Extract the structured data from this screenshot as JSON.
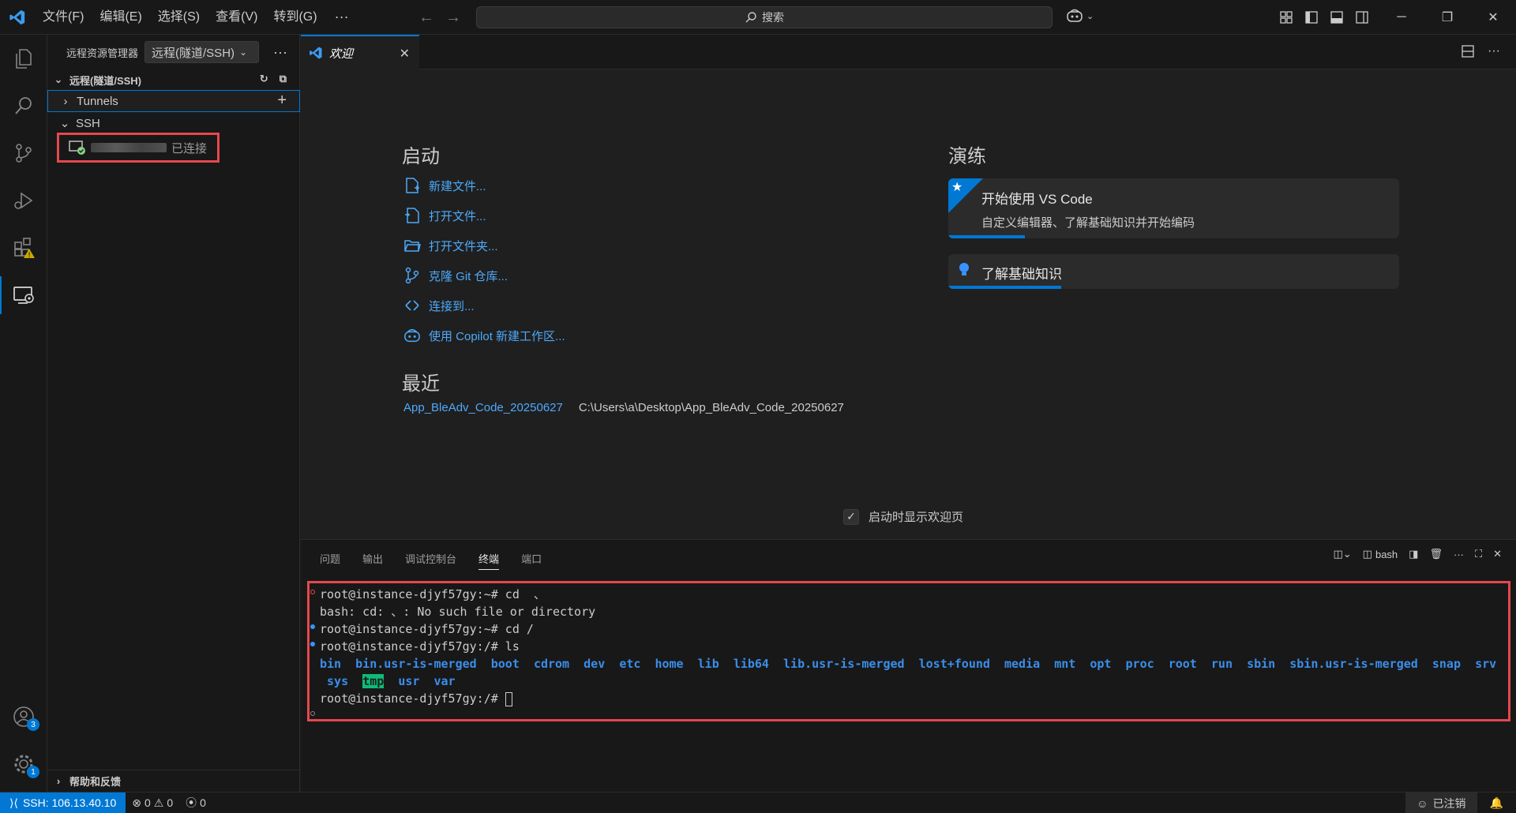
{
  "menu": [
    "文件(F)",
    "编辑(E)",
    "选择(S)",
    "查看(V)",
    "转到(G)"
  ],
  "menu_more": "···",
  "search": {
    "label": "搜索"
  },
  "sidebar": {
    "title": "远程资源管理器",
    "dropdown": "远程(隧道/SSH)",
    "more": "···",
    "section": "远程(隧道/SSH)",
    "tunnels": "Tunnels",
    "ssh": "SSH",
    "host_status": "已连接",
    "footer": "帮助和反馈"
  },
  "badges": {
    "accounts": "3",
    "settings": "1"
  },
  "tab": {
    "label": "欢迎",
    "close": "✕"
  },
  "welcome": {
    "start_heading": "启动",
    "start_items": [
      {
        "label": "新建文件...",
        "icon": "new-file-icon"
      },
      {
        "label": "打开文件...",
        "icon": "open-file-icon"
      },
      {
        "label": "打开文件夹...",
        "icon": "open-folder-icon"
      },
      {
        "label": "克隆 Git 仓库...",
        "icon": "git-icon"
      },
      {
        "label": "连接到...",
        "icon": "remote-icon"
      },
      {
        "label": "使用 Copilot 新建工作区...",
        "icon": "copilot-icon"
      }
    ],
    "recent_heading": "最近",
    "recent": {
      "name": "App_BleAdv_Code_20250627",
      "path": "C:\\Users\\a\\Desktop\\App_BleAdv_Code_20250627"
    },
    "walkthrough_heading": "演练",
    "walkthroughs": [
      {
        "title": "开始使用 VS Code",
        "desc": "自定义编辑器、了解基础知识并开始编码",
        "progress": 0.17
      },
      {
        "title": "了解基础知识",
        "desc": "",
        "progress": 0.25
      }
    ],
    "show_on_startup": "启动时显示欢迎页"
  },
  "panel": {
    "tabs": [
      "问题",
      "输出",
      "调试控制台",
      "终端",
      "端口"
    ],
    "active_tab": "终端",
    "shell": "bash"
  },
  "terminal": {
    "lines": [
      "root@instance-djyf57gy:~# cd  、",
      "bash: cd: 、: No such file or directory",
      "root@instance-djyf57gy:~# cd /",
      "root@instance-djyf57gy:/# ls"
    ],
    "dirs_row1": [
      "bin",
      "bin.usr-is-merged",
      "boot",
      "cdrom",
      "dev",
      "etc",
      "home",
      "lib",
      "lib64",
      "lib.usr-is-merged",
      "lost+found",
      "media",
      "mnt",
      "opt",
      "proc",
      "root",
      "run",
      "sbin",
      "sbin.usr-is-merged",
      "snap",
      "srv"
    ],
    "dirs_row2_a": "sys",
    "dirs_row2_tmp": "tmp",
    "dirs_row2_b": [
      "usr",
      "var"
    ],
    "prompt": "root@instance-djyf57gy:/# "
  },
  "status": {
    "remote": "SSH: 106.13.40.10",
    "errors": "0",
    "warnings": "0",
    "ports": "0",
    "signout": "已注销"
  },
  "colors": {
    "accent": "#0078d4",
    "link": "#4daafc",
    "highlight": "#e5484d",
    "terminal_dir": "#3b8eea"
  }
}
